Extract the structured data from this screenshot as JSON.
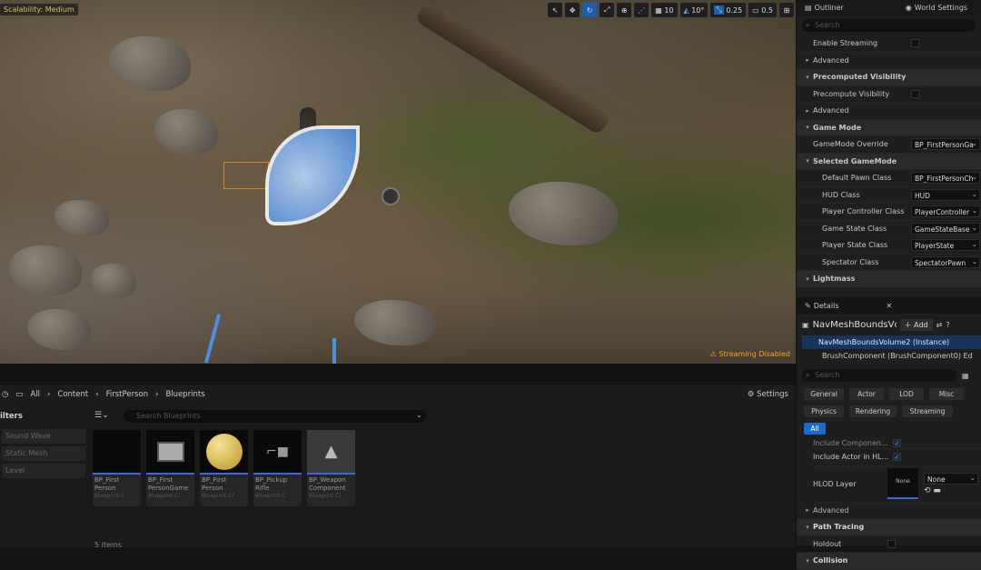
{
  "viewport": {
    "scalability": "Scalability: Medium",
    "toolbar": {
      "grid": "10",
      "angle": "10°",
      "scale": "0.25",
      "camera": "0.5"
    },
    "streaming_warning": "Streaming Disabled"
  },
  "outliner": {
    "tab_label": "Outliner",
    "world_settings_label": "World Settings",
    "search_placeholder": "Search",
    "rows": [
      {
        "label": "Enable Streaming",
        "kind": "check"
      },
      {
        "label": "Advanced",
        "kind": "sub"
      },
      {
        "label": "Precomputed Visibility",
        "kind": "section"
      },
      {
        "label": "Precompute Visibility",
        "kind": "check"
      },
      {
        "label": "Advanced",
        "kind": "sub"
      },
      {
        "label": "Game Mode",
        "kind": "section"
      },
      {
        "label": "GameMode Override",
        "kind": "dd",
        "value": "BP_FirstPersonGa"
      },
      {
        "label": "Selected GameMode",
        "kind": "section2"
      },
      {
        "label": "Default Pawn Class",
        "kind": "dd2",
        "value": "BP_FirstPersonCh"
      },
      {
        "label": "HUD Class",
        "kind": "dd2",
        "value": "HUD"
      },
      {
        "label": "Player Controller Class",
        "kind": "dd2",
        "value": "PlayerController"
      },
      {
        "label": "Game State Class",
        "kind": "dd2",
        "value": "GameStateBase"
      },
      {
        "label": "Player State Class",
        "kind": "dd2",
        "value": "PlayerState"
      },
      {
        "label": "Spectator Class",
        "kind": "dd2",
        "value": "SpectatorPawn"
      },
      {
        "label": "Lightmass",
        "kind": "section"
      }
    ]
  },
  "details": {
    "tab_label": "Details",
    "actor_name": "NavMeshBoundsVc",
    "add_label": "Add",
    "instance_label": "NavMeshBoundsVolume2 (Instance)",
    "component_label": "BrushComponent (BrushComponent0)",
    "component_extra": "Ed",
    "search_placeholder": "Search",
    "filter_tabs": [
      "General",
      "Actor",
      "LOD",
      "Misc",
      "Physics",
      "Rendering",
      "Streaming",
      "All"
    ],
    "include_components": "Include Componen...",
    "include_actor": "Include Actor in HL...",
    "hlod_layer": "HLOD Layer",
    "hlod_thumb": "None",
    "hlod_value": "None",
    "advanced": "Advanced",
    "path_tracing": "Path Tracing",
    "holdout": "Holdout",
    "collision": "Collision"
  },
  "content_browser": {
    "breadcrumb": [
      "All",
      "Content",
      "FirstPerson",
      "Blueprints"
    ],
    "settings_label": "Settings",
    "filters_label": "ilters",
    "search_placeholder": "Search Blueprints",
    "filters": [
      "Sound Wave",
      "Static Mesh",
      "Level"
    ],
    "assets": [
      {
        "name": "BP_First\nPerson",
        "type": "Blueprint C"
      },
      {
        "name": "BP_First\nPersonGame",
        "type": "Blueprint Cl"
      },
      {
        "name": "BP_First\nPerson",
        "type": "Blueprint Cl"
      },
      {
        "name": "BP_Pickup\nRifle",
        "type": "Blueprint C"
      },
      {
        "name": "BP_Weapon\nComponent",
        "type": "Blueprint Cl"
      }
    ],
    "item_count": "5 items"
  }
}
